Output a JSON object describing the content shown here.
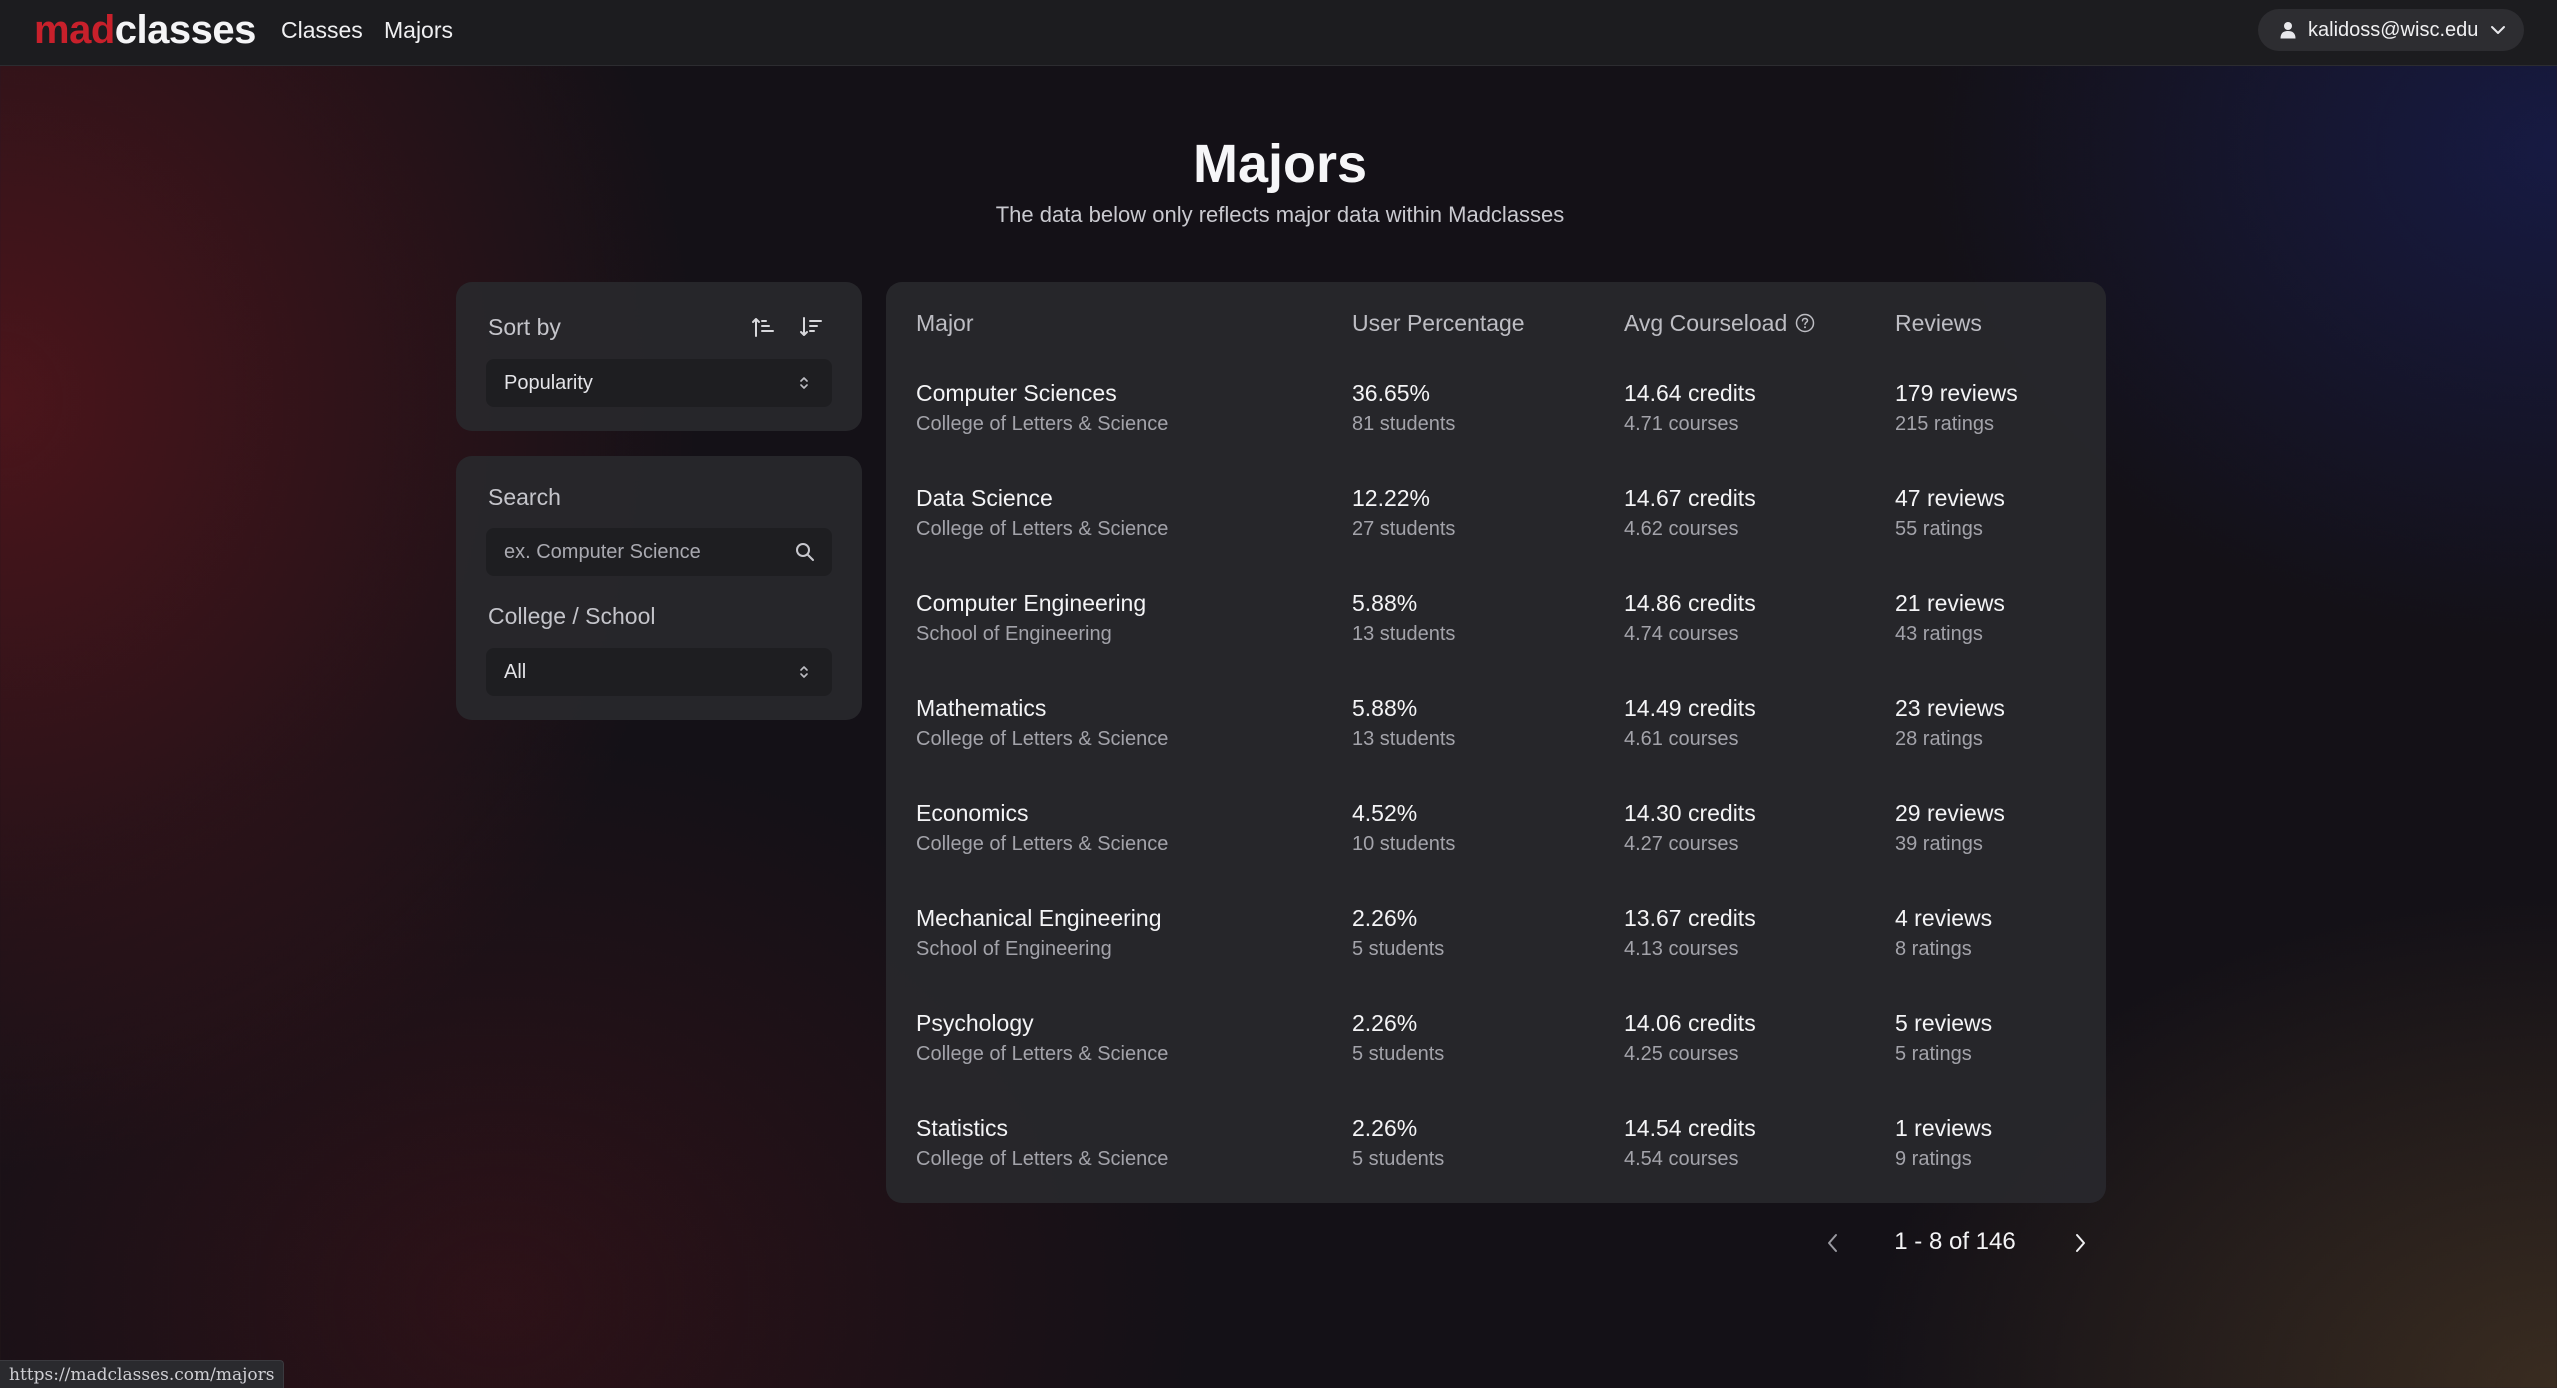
{
  "nav": {
    "logo_part1": "mad",
    "logo_part2": "classes",
    "links": [
      "Classes",
      "Majors"
    ],
    "user_email": "kalidoss@wisc.edu"
  },
  "header": {
    "title": "Majors",
    "subtitle": "The data below only reflects major data within Madclasses"
  },
  "sort": {
    "label": "Sort by",
    "selected": "Popularity"
  },
  "filters": {
    "search_label": "Search",
    "search_placeholder": "ex. Computer Science",
    "college_label": "College / School",
    "college_selected": "All"
  },
  "table": {
    "headers": [
      "Major",
      "User Percentage",
      "Avg Courseload",
      "Reviews"
    ],
    "rows": [
      {
        "major": "Computer Sciences",
        "school": "College of Letters & Science",
        "percentage": "36.65%",
        "students": "81 students",
        "credits": "14.64 credits",
        "courses": "4.71 courses",
        "reviews": "179 reviews",
        "ratings": "215 ratings"
      },
      {
        "major": "Data Science",
        "school": "College of Letters & Science",
        "percentage": "12.22%",
        "students": "27 students",
        "credits": "14.67 credits",
        "courses": "4.62 courses",
        "reviews": "47 reviews",
        "ratings": "55 ratings"
      },
      {
        "major": "Computer Engineering",
        "school": "School of Engineering",
        "percentage": "5.88%",
        "students": "13 students",
        "credits": "14.86 credits",
        "courses": "4.74 courses",
        "reviews": "21 reviews",
        "ratings": "43 ratings"
      },
      {
        "major": "Mathematics",
        "school": "College of Letters & Science",
        "percentage": "5.88%",
        "students": "13 students",
        "credits": "14.49 credits",
        "courses": "4.61 courses",
        "reviews": "23 reviews",
        "ratings": "28 ratings"
      },
      {
        "major": "Economics",
        "school": "College of Letters & Science",
        "percentage": "4.52%",
        "students": "10 students",
        "credits": "14.30 credits",
        "courses": "4.27 courses",
        "reviews": "29 reviews",
        "ratings": "39 ratings"
      },
      {
        "major": "Mechanical Engineering",
        "school": "School of Engineering",
        "percentage": "2.26%",
        "students": "5 students",
        "credits": "13.67 credits",
        "courses": "4.13 courses",
        "reviews": "4 reviews",
        "ratings": "8 ratings"
      },
      {
        "major": "Psychology",
        "school": "College of Letters & Science",
        "percentage": "2.26%",
        "students": "5 students",
        "credits": "14.06 credits",
        "courses": "4.25 courses",
        "reviews": "5 reviews",
        "ratings": "5 ratings"
      },
      {
        "major": "Statistics",
        "school": "College of Letters & Science",
        "percentage": "2.26%",
        "students": "5 students",
        "credits": "14.54 credits",
        "courses": "4.54 courses",
        "reviews": "1 reviews",
        "ratings": "9 ratings"
      }
    ]
  },
  "pagination": {
    "text": "1 - 8 of 146"
  },
  "status_bar": {
    "url": "https://madclasses.com/majors"
  },
  "icons": {
    "user": "user-icon",
    "chevron": "chevron-down-icon",
    "sort_asc": "sort-ascending-icon",
    "sort_desc": "sort-descending-icon",
    "select": "select-updown-icon",
    "search": "search-icon",
    "help": "help-circle-icon",
    "prev": "chevron-left-icon",
    "next": "chevron-right-icon"
  },
  "colors": {
    "brand_red": "#c8202b",
    "panel": "#28282c",
    "nav": "#1c1c1f"
  }
}
